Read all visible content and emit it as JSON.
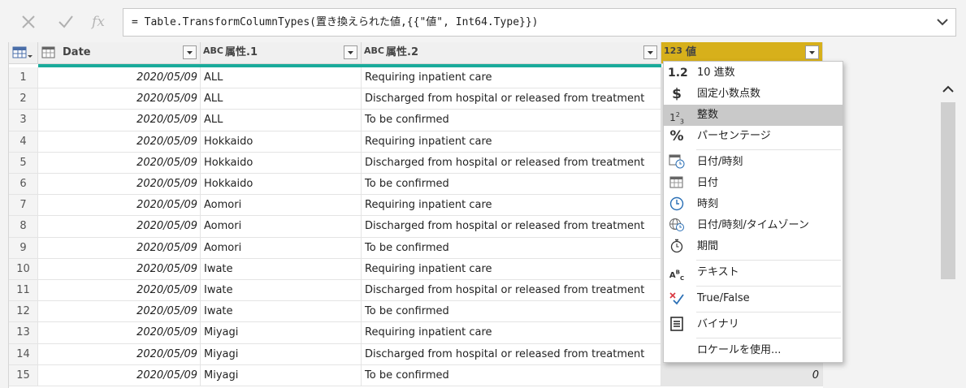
{
  "formula_bar": {
    "cancel_icon": "x-icon",
    "commit_icon": "check-icon",
    "fx_label": "fx",
    "formula": "= Table.TransformColumnTypes(置き換えられた値,{{\"値\", Int64.Type}})"
  },
  "table": {
    "columns": [
      {
        "type": "date",
        "type_label": "",
        "name": "Date"
      },
      {
        "type": "text",
        "type_label": "ABC",
        "name": "属性.1"
      },
      {
        "type": "text",
        "type_label": "ABC",
        "name": "属性.2"
      },
      {
        "type": "integer",
        "type_label": "123",
        "name": "値"
      }
    ],
    "rows": [
      {
        "n": "1",
        "date": "2020/05/09",
        "attr1": "ALL",
        "attr2": "Requiring inpatient care",
        "value": ""
      },
      {
        "n": "2",
        "date": "2020/05/09",
        "attr1": "ALL",
        "attr2": "Discharged from hospital or released from treatment",
        "value": ""
      },
      {
        "n": "3",
        "date": "2020/05/09",
        "attr1": "ALL",
        "attr2": "To be confirmed",
        "value": ""
      },
      {
        "n": "4",
        "date": "2020/05/09",
        "attr1": "Hokkaido",
        "attr2": "Requiring inpatient care",
        "value": ""
      },
      {
        "n": "5",
        "date": "2020/05/09",
        "attr1": "Hokkaido",
        "attr2": "Discharged from hospital or released from treatment",
        "value": ""
      },
      {
        "n": "6",
        "date": "2020/05/09",
        "attr1": "Hokkaido",
        "attr2": "To be confirmed",
        "value": ""
      },
      {
        "n": "7",
        "date": "2020/05/09",
        "attr1": "Aomori",
        "attr2": "Requiring inpatient care",
        "value": ""
      },
      {
        "n": "8",
        "date": "2020/05/09",
        "attr1": "Aomori",
        "attr2": "Discharged from hospital or released from treatment",
        "value": ""
      },
      {
        "n": "9",
        "date": "2020/05/09",
        "attr1": "Aomori",
        "attr2": "To be confirmed",
        "value": ""
      },
      {
        "n": "10",
        "date": "2020/05/09",
        "attr1": "Iwate",
        "attr2": "Requiring inpatient care",
        "value": ""
      },
      {
        "n": "11",
        "date": "2020/05/09",
        "attr1": "Iwate",
        "attr2": "Discharged from hospital or released from treatment",
        "value": ""
      },
      {
        "n": "12",
        "date": "2020/05/09",
        "attr1": "Iwate",
        "attr2": "To be confirmed",
        "value": ""
      },
      {
        "n": "13",
        "date": "2020/05/09",
        "attr1": "Miyagi",
        "attr2": "Requiring inpatient care",
        "value": ""
      },
      {
        "n": "14",
        "date": "2020/05/09",
        "attr1": "Miyagi",
        "attr2": "Discharged from hospital or released from treatment",
        "value": ""
      },
      {
        "n": "15",
        "date": "2020/05/09",
        "attr1": "Miyagi",
        "attr2": "To be confirmed",
        "value": "0"
      }
    ]
  },
  "type_menu": {
    "items": [
      {
        "icon": "1.2",
        "icon_name": "decimal-icon",
        "label": "10 進数",
        "highlighted": false
      },
      {
        "icon": "$",
        "icon_name": "currency-icon",
        "label": "固定小数点数",
        "highlighted": false
      },
      {
        "icon": "123",
        "icon_name": "integer-icon",
        "label": "整数",
        "highlighted": true
      },
      {
        "icon": "%",
        "icon_name": "percent-icon",
        "label": "パーセンテージ",
        "highlighted": false
      },
      {
        "icon": "",
        "icon_name": "datetime-icon",
        "label": "日付/時刻",
        "highlighted": false
      },
      {
        "icon": "",
        "icon_name": "date-icon",
        "label": "日付",
        "highlighted": false
      },
      {
        "icon": "",
        "icon_name": "time-icon",
        "label": "時刻",
        "highlighted": false
      },
      {
        "icon": "",
        "icon_name": "timezone-icon",
        "label": "日付/時刻/タイムゾーン",
        "highlighted": false
      },
      {
        "icon": "",
        "icon_name": "duration-icon",
        "label": "期間",
        "highlighted": false
      },
      {
        "icon": "ABC",
        "icon_name": "text-icon",
        "label": "テキスト",
        "highlighted": false
      },
      {
        "icon": "",
        "icon_name": "truefalse-icon",
        "label": "True/False",
        "highlighted": false
      },
      {
        "icon": "",
        "icon_name": "binary-icon",
        "label": "バイナリ",
        "highlighted": false
      },
      {
        "icon": "",
        "icon_name": "",
        "label": "ロケールを使用...",
        "highlighted": false
      }
    ]
  },
  "colors": {
    "selected_header": "#d7b01b",
    "quality_bar": "#1aab9b",
    "menu_highlight": "#c9c9c9"
  }
}
